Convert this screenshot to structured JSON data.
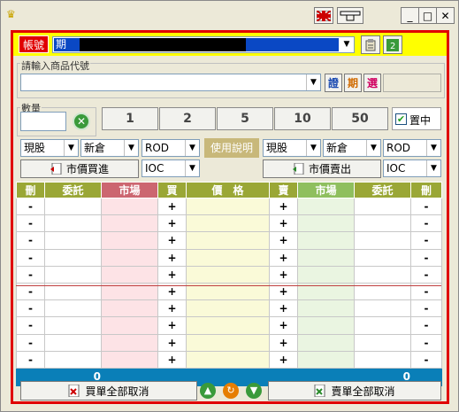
{
  "window": {
    "minimize": "_",
    "maximize": "□",
    "close": "✕"
  },
  "account": {
    "label": "帳號",
    "value": "期"
  },
  "product": {
    "legend": "請輸入商品代號",
    "value": "",
    "btn_zheng": "證",
    "btn_qi": "期",
    "btn_xuan": "選"
  },
  "quantity": {
    "legend": "數量",
    "value": "",
    "quick": [
      "1",
      "2",
      "5",
      "10",
      "50"
    ],
    "center_label": "置中",
    "center_checked": true
  },
  "buy_controls": {
    "type": "現股",
    "position": "新倉",
    "order": "ROD",
    "market_btn": "市價買進",
    "tif": "IOC"
  },
  "instructions_btn": "使用說明",
  "sell_controls": {
    "type": "現股",
    "position": "新倉",
    "order": "ROD",
    "market_btn": "市價賣出",
    "tif": "IOC"
  },
  "table": {
    "headers": [
      "刪",
      "委託",
      "市場",
      "買",
      "價　格",
      "賣",
      "市場",
      "委託",
      "刪"
    ],
    "rows": [
      [
        "-",
        "",
        "",
        "+",
        "",
        "+",
        "",
        "",
        "-"
      ],
      [
        "-",
        "",
        "",
        "+",
        "",
        "+",
        "",
        "",
        "-"
      ],
      [
        "-",
        "",
        "",
        "+",
        "",
        "+",
        "",
        "",
        "-"
      ],
      [
        "-",
        "",
        "",
        "+",
        "",
        "+",
        "",
        "",
        "-"
      ],
      [
        "-",
        "",
        "",
        "+",
        "",
        "+",
        "",
        "",
        "-"
      ],
      [
        "-",
        "",
        "",
        "+",
        "",
        "+",
        "",
        "",
        "-"
      ],
      [
        "-",
        "",
        "",
        "+",
        "",
        "+",
        "",
        "",
        "-"
      ],
      [
        "-",
        "",
        "",
        "+",
        "",
        "+",
        "",
        "",
        "-"
      ],
      [
        "-",
        "",
        "",
        "+",
        "",
        "+",
        "",
        "",
        "-"
      ],
      [
        "-",
        "",
        "",
        "+",
        "",
        "+",
        "",
        "",
        "-"
      ]
    ],
    "footer": [
      "",
      "0",
      "",
      "",
      "",
      "",
      "",
      "0",
      ""
    ]
  },
  "bottom": {
    "buy_cancel": "買單全部取消",
    "sell_cancel": "賣單全部取消"
  },
  "colors": {
    "frame_red": "#e00000",
    "header_olive": "#9aa736",
    "header_pink": "#cc6670",
    "header_green": "#8fbf5e",
    "footer_blue": "#0a7fb8",
    "col_pink": "#fde3e6",
    "col_yellow": "#fafad8",
    "col_green": "#eaf5e1"
  }
}
